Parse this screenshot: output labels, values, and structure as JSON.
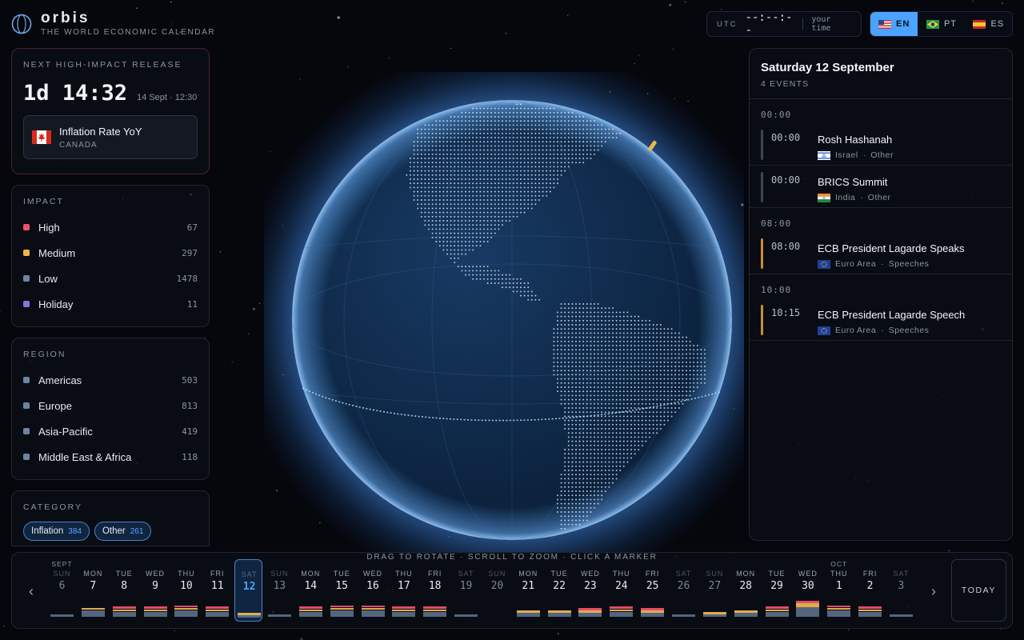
{
  "brand": {
    "name": "orbis",
    "tagline": "THE WORLD ECONOMIC CALENDAR"
  },
  "clock": {
    "label": "UTC",
    "time": "--:--:--",
    "local": "your time"
  },
  "languages": [
    {
      "code": "EN",
      "active": true
    },
    {
      "code": "PT",
      "active": false
    },
    {
      "code": "ES",
      "active": false
    }
  ],
  "next_release": {
    "title": "NEXT HIGH-IMPACT RELEASE",
    "countdown": "1d 14:32",
    "when": "14 Sept · 12:30",
    "event": "Inflation Rate YoY",
    "country": "CANADA"
  },
  "impact": {
    "title": "IMPACT",
    "items": [
      {
        "label": "High",
        "count": "67",
        "color": "#f0506e"
      },
      {
        "label": "Medium",
        "count": "297",
        "color": "#f0b44c"
      },
      {
        "label": "Low",
        "count": "1478",
        "color": "#6e84a3"
      },
      {
        "label": "Holiday",
        "count": "11",
        "color": "#8a72d8"
      }
    ]
  },
  "region": {
    "title": "REGION",
    "items": [
      {
        "label": "Americas",
        "count": "503",
        "color": "#6e84a3"
      },
      {
        "label": "Europe",
        "count": "813",
        "color": "#6e84a3"
      },
      {
        "label": "Asia-Pacific",
        "count": "419",
        "color": "#6e84a3"
      },
      {
        "label": "Middle East & Africa",
        "count": "118",
        "color": "#6e84a3"
      }
    ]
  },
  "category": {
    "title": "CATEGORY",
    "chips": [
      {
        "label": "Inflation",
        "count": "384"
      },
      {
        "label": "Other",
        "count": "261"
      }
    ]
  },
  "hint": "DRAG TO ROTATE · SCROLL TO ZOOM · CLICK A MARKER",
  "day_panel": {
    "title": "Saturday 12 September",
    "count": "4 EVENTS",
    "groups": [
      {
        "time": "00:00",
        "events": [
          {
            "time": "00:00",
            "name": "Rosh Hashanah",
            "country": "Israel",
            "category": "Other",
            "flag": "israel-flag",
            "impact": "holiday"
          },
          {
            "time": "00:00",
            "name": "BRICS Summit",
            "country": "India",
            "category": "Other",
            "flag": "india-flag",
            "impact": "holiday"
          }
        ]
      },
      {
        "time": "08:00",
        "events": [
          {
            "time": "08:00",
            "name": "ECB President Lagarde Speaks",
            "country": "Euro Area",
            "category": "Speeches",
            "flag": "eu-flag",
            "impact": "medium"
          }
        ]
      },
      {
        "time": "10:00",
        "events": [
          {
            "time": "10:15",
            "name": "ECB President Lagarde Speech",
            "country": "Euro Area",
            "category": "Speeches",
            "flag": "eu-flag",
            "impact": "medium"
          }
        ]
      }
    ]
  },
  "timeline": {
    "today_label": "TODAY",
    "days": [
      {
        "month": "SEPT",
        "dow": "SUN",
        "num": "6",
        "weekend": true,
        "bars": [
          0,
          0,
          1
        ]
      },
      {
        "dow": "MON",
        "num": "7",
        "bars": [
          0,
          1,
          4
        ]
      },
      {
        "dow": "TUE",
        "num": "8",
        "bars": [
          1,
          1,
          3
        ]
      },
      {
        "dow": "WED",
        "num": "9",
        "bars": [
          1,
          1,
          3
        ]
      },
      {
        "dow": "THU",
        "num": "10",
        "bars": [
          1,
          1,
          4
        ]
      },
      {
        "dow": "FRI",
        "num": "11",
        "bars": [
          1,
          1,
          3
        ]
      },
      {
        "dow": "SAT",
        "num": "12",
        "weekend": true,
        "selected": true,
        "bars": [
          0,
          1,
          1
        ]
      },
      {
        "dow": "SUN",
        "num": "13",
        "weekend": true,
        "bars": [
          0,
          0,
          1
        ]
      },
      {
        "dow": "MON",
        "num": "14",
        "bars": [
          1,
          1,
          3
        ]
      },
      {
        "dow": "TUE",
        "num": "15",
        "bars": [
          1,
          1,
          4
        ]
      },
      {
        "dow": "WED",
        "num": "16",
        "bars": [
          1,
          1,
          4
        ]
      },
      {
        "dow": "THU",
        "num": "17",
        "bars": [
          1,
          1,
          3
        ]
      },
      {
        "dow": "FRI",
        "num": "18",
        "bars": [
          1,
          1,
          3
        ]
      },
      {
        "dow": "SAT",
        "num": "19",
        "weekend": true,
        "bars": [
          0,
          0,
          1
        ]
      },
      {
        "dow": "SUN",
        "num": "20",
        "weekend": true,
        "bars": [
          0,
          0,
          0
        ]
      },
      {
        "dow": "MON",
        "num": "21",
        "bars": [
          0,
          1,
          2
        ]
      },
      {
        "dow": "TUE",
        "num": "22",
        "bars": [
          0,
          1,
          2
        ]
      },
      {
        "dow": "WED",
        "num": "23",
        "bars": [
          1,
          1,
          2
        ]
      },
      {
        "dow": "THU",
        "num": "24",
        "bars": [
          1,
          1,
          3
        ]
      },
      {
        "dow": "FRI",
        "num": "25",
        "bars": [
          1,
          1,
          2
        ]
      },
      {
        "dow": "SAT",
        "num": "26",
        "weekend": true,
        "bars": [
          0,
          0,
          1
        ]
      },
      {
        "dow": "SUN",
        "num": "27",
        "weekend": true,
        "bars": [
          0,
          1,
          1
        ]
      },
      {
        "dow": "MON",
        "num": "28",
        "bars": [
          0,
          1,
          2
        ]
      },
      {
        "dow": "TUE",
        "num": "29",
        "bars": [
          1,
          1,
          3
        ]
      },
      {
        "dow": "WED",
        "num": "30",
        "bars": [
          1,
          2,
          6
        ]
      },
      {
        "month": "OCT",
        "dow": "THU",
        "num": "1",
        "bars": [
          1,
          1,
          4
        ]
      },
      {
        "dow": "FRI",
        "num": "2",
        "bars": [
          1,
          1,
          3
        ]
      },
      {
        "dow": "SAT",
        "num": "3",
        "weekend": true,
        "bars": [
          0,
          0,
          1
        ]
      }
    ]
  },
  "colors": {
    "high": "#f0506e",
    "medium": "#f0b44c",
    "low": "#6e84a3",
    "holiday": "#8a72d8",
    "accent": "#4aa3ff",
    "bg": "#05070c"
  }
}
